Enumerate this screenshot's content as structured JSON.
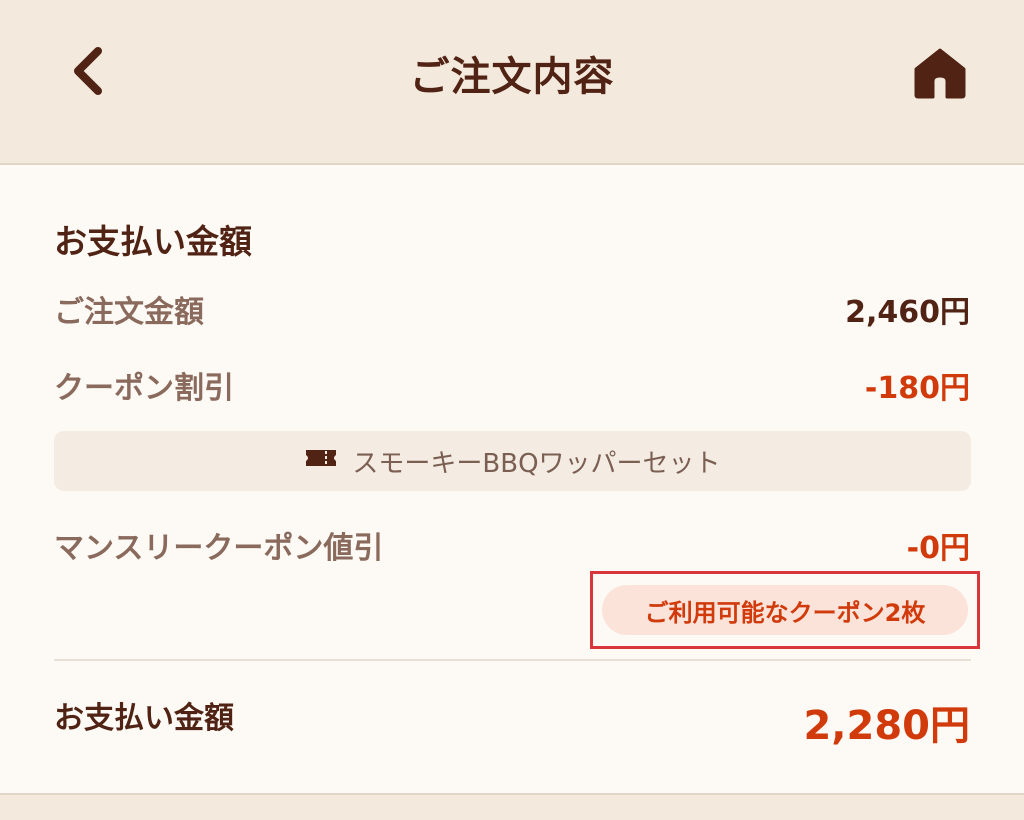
{
  "header": {
    "title": "ご注文内容",
    "back_icon": "chevron-left-icon",
    "home_icon": "home-icon"
  },
  "payment": {
    "section_title": "お支払い金額",
    "order_amount_label": "ご注文金額",
    "order_amount_value": "2,460円",
    "coupon_discount_label": "クーポン割引",
    "coupon_discount_value": "-180円",
    "applied_coupon_name": "スモーキーBBQワッパーセット",
    "applied_coupon_icon": "ticket-icon",
    "monthly_coupon_label": "マンスリークーポン値引",
    "monthly_coupon_value": "-0円",
    "available_coupons_button": "ご利用可能なクーポン2枚",
    "total_label": "お支払い金額",
    "total_value": "2,280円"
  },
  "colors": {
    "brand_brown": "#502314",
    "accent_red": "#d13a0b",
    "background": "#f3e9dc",
    "highlight_border": "#d8363b"
  }
}
